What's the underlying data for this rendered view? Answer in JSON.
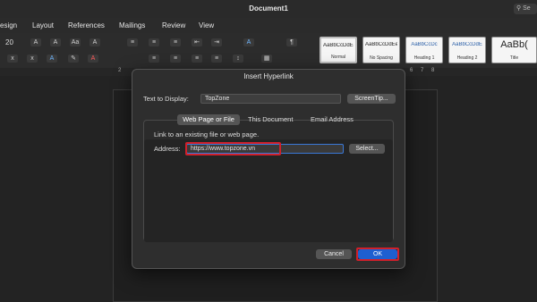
{
  "window": {
    "title": "Document1",
    "search_placeholder": "Se"
  },
  "menu": [
    "esign",
    "Layout",
    "References",
    "Mailings",
    "Review",
    "View"
  ],
  "ribbon": {
    "font_size": "20",
    "styles": [
      {
        "sample": "AaBbCcDdEe",
        "label": "Normal"
      },
      {
        "sample": "AaBbCcDdEe",
        "label": "No Spacing"
      },
      {
        "sample": "AaBbCcDc",
        "label": "Heading 1"
      },
      {
        "sample": "AaBbCcDdE",
        "label": "Heading 2"
      },
      {
        "sample": "AaBb(",
        "label": "Title"
      }
    ]
  },
  "ruler": {
    "mark_left": "2",
    "mark_right_a": "6",
    "mark_right_b": "7",
    "mark_right_c": "8"
  },
  "dialog": {
    "title": "Insert Hyperlink",
    "text_to_display_label": "Text to Display:",
    "text_to_display_value": "TopZone",
    "screentip_button": "ScreenTip...",
    "tabs": [
      "Web Page or File",
      "This Document",
      "Email Address"
    ],
    "active_tab": "Web Page or File",
    "hint": "Link to an existing file or web page.",
    "address_label": "Address:",
    "address_value": "https://www.topzone.vn",
    "select_button": "Select...",
    "cancel_button": "Cancel",
    "ok_button": "OK"
  },
  "colors": {
    "accent": "#1e5fd0",
    "highlight": "#d0202a"
  }
}
